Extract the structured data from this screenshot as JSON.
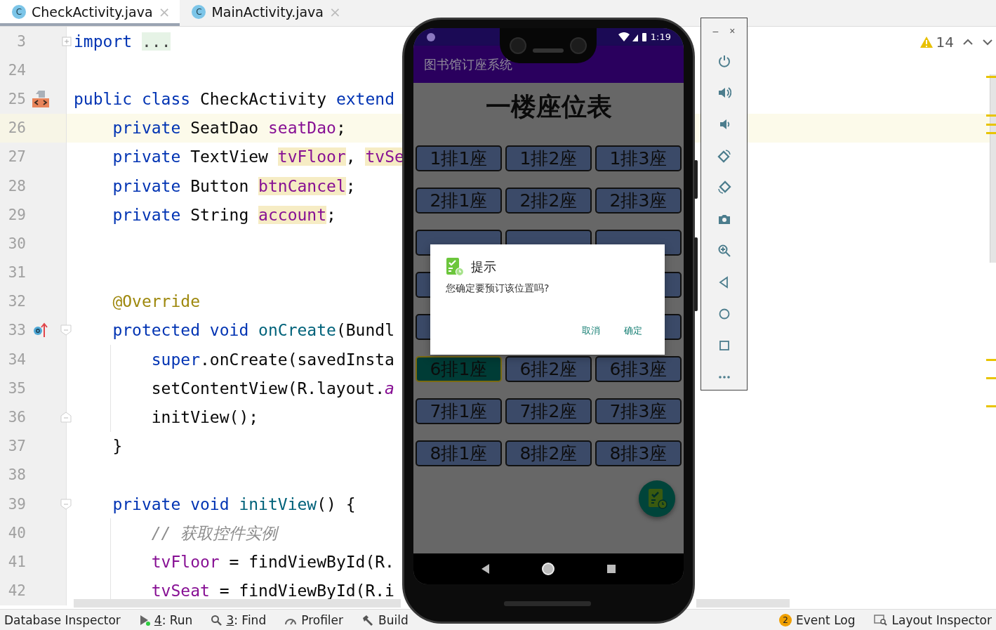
{
  "tabs": [
    {
      "icon_letter": "C",
      "label": "CheckActivity.java",
      "close": "×",
      "selected": true
    },
    {
      "icon_letter": "C",
      "label": "MainActivity.java",
      "close": "×",
      "selected": false
    }
  ],
  "editor": {
    "warnings": "14",
    "lines": [
      {
        "number": "3",
        "tokens": [
          {
            "text": "import ",
            "kind": "keyword"
          },
          {
            "text": "...",
            "kind": "folded"
          }
        ]
      },
      {
        "number": "24"
      },
      {
        "number": "25",
        "tokens": [
          {
            "text": "public class ",
            "kind": "keyword"
          },
          {
            "text": "CheckActivity ",
            "kind": "plain"
          },
          {
            "text": "extend",
            "kind": "keyword"
          }
        ]
      },
      {
        "number": "26",
        "current": true,
        "tokens": [
          {
            "text": "    private ",
            "kind": "keyword"
          },
          {
            "text": "SeatDao ",
            "kind": "plain"
          },
          {
            "text": "seatDao",
            "kind": "field"
          },
          {
            "text": ";",
            "kind": "plain"
          }
        ]
      },
      {
        "number": "27",
        "tokens": [
          {
            "text": "    private ",
            "kind": "keyword"
          },
          {
            "text": "TextView ",
            "kind": "plain"
          },
          {
            "text": "tvFloor",
            "kind": "field",
            "highlighted": true
          },
          {
            "text": ", ",
            "kind": "plain"
          },
          {
            "text": "tvSe",
            "kind": "field",
            "highlighted": true
          }
        ]
      },
      {
        "number": "28",
        "tokens": [
          {
            "text": "    private ",
            "kind": "keyword"
          },
          {
            "text": "Button ",
            "kind": "plain"
          },
          {
            "text": "btnCancel",
            "kind": "field",
            "highlighted": true
          },
          {
            "text": ";",
            "kind": "plain"
          }
        ]
      },
      {
        "number": "29",
        "tokens": [
          {
            "text": "    private ",
            "kind": "keyword"
          },
          {
            "text": "String ",
            "kind": "plain"
          },
          {
            "text": "account",
            "kind": "field",
            "highlighted": true
          },
          {
            "text": ";",
            "kind": "plain"
          }
        ]
      },
      {
        "number": "30"
      },
      {
        "number": "31"
      },
      {
        "number": "32",
        "tokens": [
          {
            "text": "    @Override",
            "kind": "annotation"
          }
        ]
      },
      {
        "number": "33",
        "tokens": [
          {
            "text": "    protected void ",
            "kind": "keyword"
          },
          {
            "text": "onCreate",
            "kind": "method"
          },
          {
            "text": "(Bundl",
            "kind": "plain"
          }
        ]
      },
      {
        "number": "34",
        "tokens": [
          {
            "text": "        super",
            "kind": "keyword"
          },
          {
            "text": ".onCreate(savedInsta",
            "kind": "plain"
          }
        ]
      },
      {
        "number": "35",
        "tokens": [
          {
            "text": "        setContentView(R.layout.",
            "kind": "plain"
          },
          {
            "text": "a",
            "kind": "static"
          }
        ]
      },
      {
        "number": "36",
        "tokens": [
          {
            "text": "        initView();",
            "kind": "plain"
          }
        ]
      },
      {
        "number": "37",
        "tokens": [
          {
            "text": "    }",
            "kind": "plain"
          }
        ]
      },
      {
        "number": "38"
      },
      {
        "number": "39",
        "tokens": [
          {
            "text": "    private void ",
            "kind": "keyword"
          },
          {
            "text": "initView",
            "kind": "method"
          },
          {
            "text": "() {",
            "kind": "plain"
          }
        ]
      },
      {
        "number": "40",
        "tokens": [
          {
            "text": "        // 获取控件实例",
            "kind": "comment"
          }
        ]
      },
      {
        "number": "41",
        "tokens": [
          {
            "text": "        tvFloor",
            "kind": "field"
          },
          {
            "text": " = findViewById(R.",
            "kind": "plain"
          }
        ]
      },
      {
        "number": "42",
        "tokens": [
          {
            "text": "        tvSeat",
            "kind": "field"
          },
          {
            "text": " = findViewById(R.i",
            "kind": "plain"
          }
        ]
      }
    ]
  },
  "emulator": {
    "window_controls": [
      "–",
      "×"
    ],
    "phone": {
      "time": "1:19",
      "app_title": "图书馆订座系统",
      "heading": "一楼座位表",
      "seat_rows": [
        [
          {
            "label": "1排1座",
            "selected": false
          },
          {
            "label": "1排2座",
            "selected": false
          },
          {
            "label": "1排3座",
            "selected": false
          }
        ],
        [
          {
            "label": "2排1座",
            "selected": false
          },
          {
            "label": "2排2座",
            "selected": false
          },
          {
            "label": "2排3座",
            "selected": false
          }
        ],
        [
          {
            "label": "6排1座",
            "selected": true
          },
          {
            "label": "6排2座",
            "selected": false
          },
          {
            "label": "6排3座",
            "selected": false
          }
        ],
        [
          {
            "label": "7排1座",
            "selected": false
          },
          {
            "label": "7排2座",
            "selected": false
          },
          {
            "label": "7排3座",
            "selected": false
          }
        ],
        [
          {
            "label": "8排1座",
            "selected": false
          },
          {
            "label": "8排2座",
            "selected": false
          },
          {
            "label": "8排3座",
            "selected": false
          }
        ]
      ],
      "dialog": {
        "title": "提示",
        "message": "您确定要预订该位置吗?",
        "buttons": [
          "取消",
          "确定"
        ]
      }
    }
  },
  "status_bar": {
    "left": [
      {
        "label": "Database Inspector"
      },
      {
        "label": "4: Run",
        "underline_first": true
      },
      {
        "label": "3: Find",
        "underline_first": true
      },
      {
        "label": "Profiler"
      },
      {
        "label": "Build"
      }
    ],
    "right": [
      {
        "label": "Event Log",
        "badge": "2"
      },
      {
        "label": "Layout Inspector"
      }
    ]
  }
}
